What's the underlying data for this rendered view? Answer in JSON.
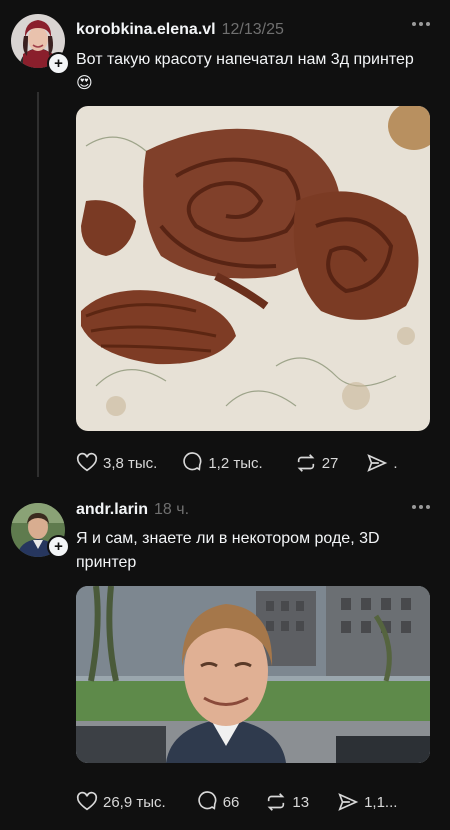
{
  "posts": [
    {
      "username": "korobkina.elena.vl",
      "time": "12/13/25",
      "text": "Вот такую красоту напечатал нам 3д принтер😍",
      "likes": "3,8 тыс.",
      "comments": "1,2 тыс.",
      "reposts": "27",
      "shares": "."
    },
    {
      "username": "andr.larin",
      "time": "18 ч.",
      "text": "Я и сам, знаете ли в некотором роде, 3D принтер",
      "likes": "26,9 тыс.",
      "comments": "66",
      "reposts": "13",
      "shares": "1,1..."
    }
  ],
  "icons": {
    "like": "heart-icon",
    "comment": "comment-icon",
    "repost": "repost-icon",
    "share": "share-icon",
    "more": "more-icon",
    "follow": "plus-icon"
  },
  "colors": {
    "background": "#101010",
    "text": "#f3f5f7",
    "secondary": "#6f6f6f"
  }
}
